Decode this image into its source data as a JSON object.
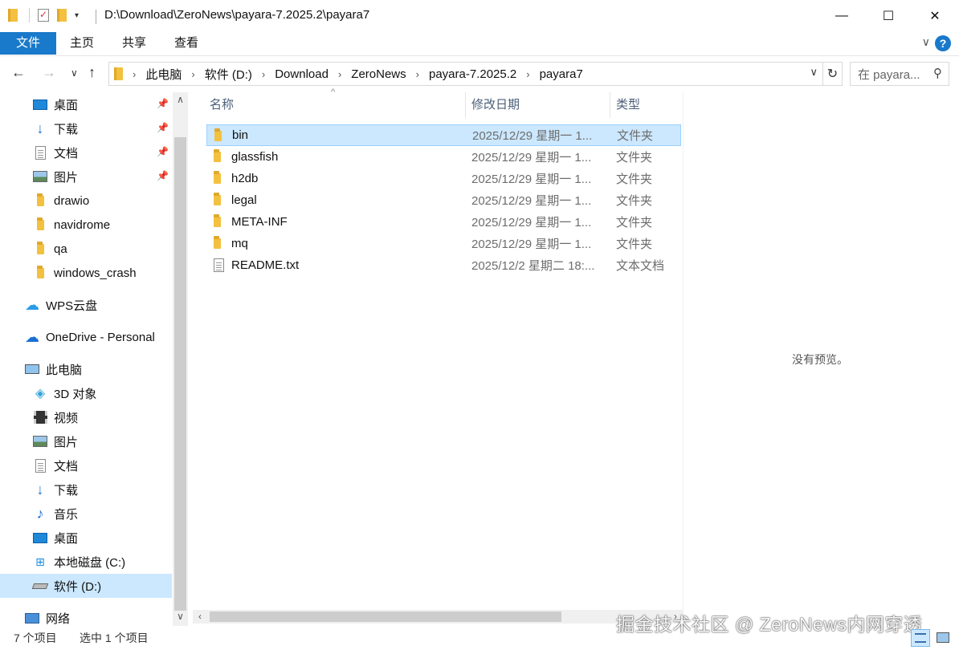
{
  "window": {
    "title": "D:\\Download\\ZeroNews\\payara-7.2025.2\\payara7",
    "minimize_glyph": "—",
    "maximize_glyph": "☐",
    "close_glyph": "✕"
  },
  "ribbon": {
    "tabs": [
      "文件",
      "主页",
      "共享",
      "查看"
    ],
    "help_glyph": "?"
  },
  "address": {
    "breadcrumbs": [
      "此电脑",
      "软件 (D:)",
      "Download",
      "ZeroNews",
      "payara-7.2025.2",
      "payara7"
    ],
    "search_placeholder": "在 payara..."
  },
  "sidebar": {
    "quick_access": [
      {
        "label": "桌面",
        "icon": "desktop-icon",
        "pinned": true
      },
      {
        "label": "下载",
        "icon": "download-icon",
        "pinned": true
      },
      {
        "label": "文档",
        "icon": "document-icon",
        "pinned": true
      },
      {
        "label": "图片",
        "icon": "pictures-icon",
        "pinned": true
      },
      {
        "label": "drawio",
        "icon": "folder-icon",
        "pinned": false
      },
      {
        "label": "navidrome",
        "icon": "folder-icon",
        "pinned": false
      },
      {
        "label": "qa",
        "icon": "folder-icon",
        "pinned": false
      },
      {
        "label": "windows_crash",
        "icon": "folder-icon",
        "pinned": false
      }
    ],
    "wps": "WPS云盘",
    "onedrive": "OneDrive - Personal",
    "this_pc": "此电脑",
    "pc_items": [
      {
        "label": "3D 对象",
        "icon": "3d-objects-icon"
      },
      {
        "label": "视频",
        "icon": "video-icon"
      },
      {
        "label": "图片",
        "icon": "pictures-icon"
      },
      {
        "label": "文档",
        "icon": "document-icon"
      },
      {
        "label": "下载",
        "icon": "download-icon"
      },
      {
        "label": "音乐",
        "icon": "music-icon"
      },
      {
        "label": "桌面",
        "icon": "desktop-icon"
      },
      {
        "label": "本地磁盘 (C:)",
        "icon": "drive-c-icon"
      },
      {
        "label": "软件 (D:)",
        "icon": "drive-d-icon",
        "selected": true
      }
    ],
    "network": "网络"
  },
  "columns": {
    "name": "名称",
    "date": "修改日期",
    "type": "类型"
  },
  "files": [
    {
      "name": "bin",
      "date": "2025/12/29 星期一 1...",
      "type": "文件夹",
      "kind": "folder",
      "selected": true
    },
    {
      "name": "glassfish",
      "date": "2025/12/29 星期一 1...",
      "type": "文件夹",
      "kind": "folder"
    },
    {
      "name": "h2db",
      "date": "2025/12/29 星期一 1...",
      "type": "文件夹",
      "kind": "folder"
    },
    {
      "name": "legal",
      "date": "2025/12/29 星期一 1...",
      "type": "文件夹",
      "kind": "folder"
    },
    {
      "name": "META-INF",
      "date": "2025/12/29 星期一 1...",
      "type": "文件夹",
      "kind": "folder"
    },
    {
      "name": "mq",
      "date": "2025/12/29 星期一 1...",
      "type": "文件夹",
      "kind": "folder"
    },
    {
      "name": "README.txt",
      "date": "2025/12/2 星期二 18:...",
      "type": "文本文档",
      "kind": "text"
    }
  ],
  "preview": {
    "message": "没有预览。"
  },
  "status": {
    "item_count": "7 个项目",
    "selection": "选中 1 个项目"
  },
  "watermark": "掘金技术社区 @ ZeroNews内网穿透"
}
